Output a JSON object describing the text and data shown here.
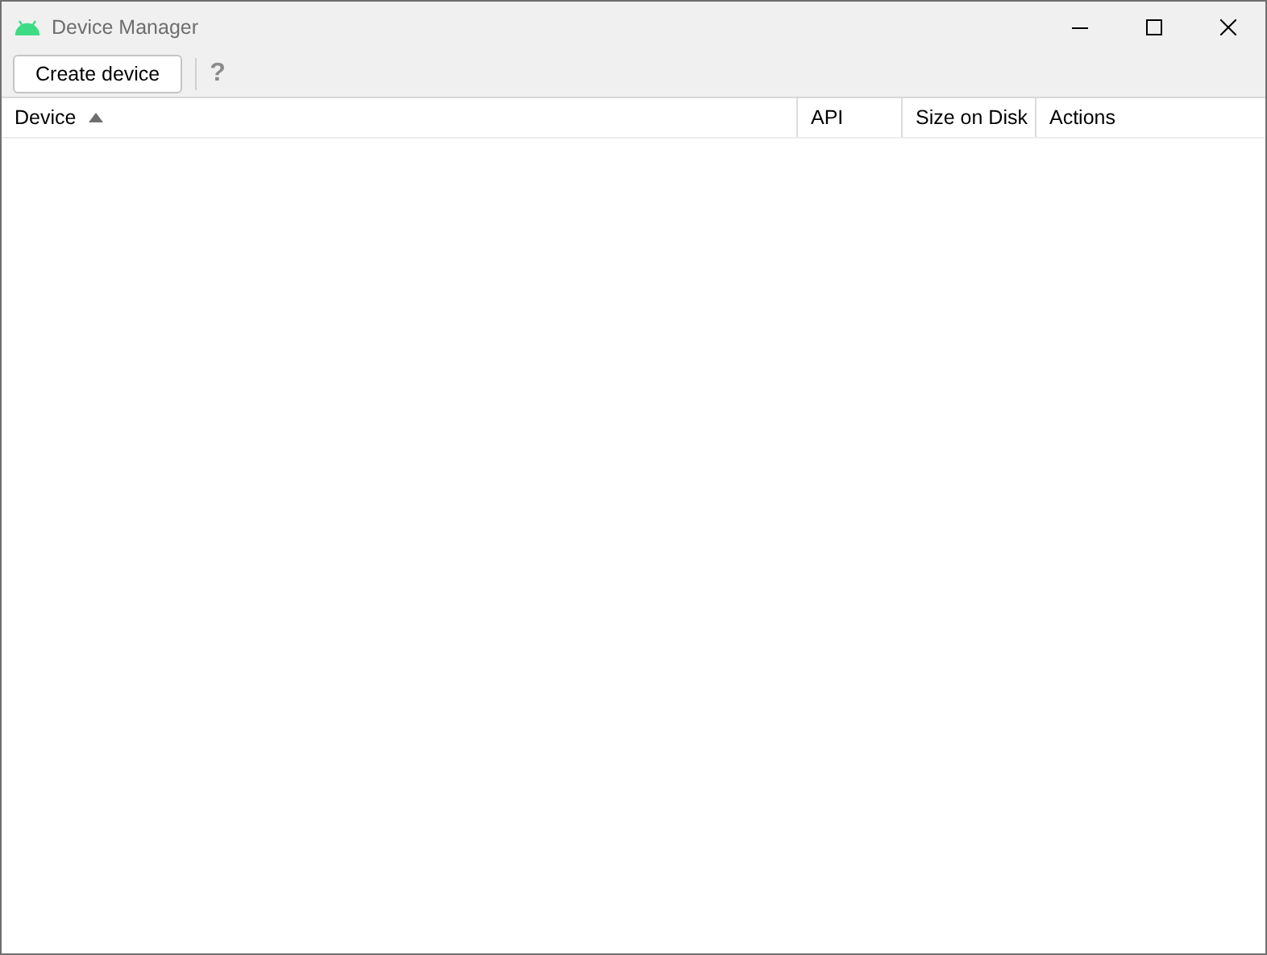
{
  "window": {
    "title": "Device Manager"
  },
  "toolbar": {
    "create_button": "Create device",
    "help": "?"
  },
  "table": {
    "columns": [
      {
        "label": "Device",
        "sorted": true
      },
      {
        "label": "API",
        "sorted": false
      },
      {
        "label": "Size on Disk",
        "sorted": false
      },
      {
        "label": "Actions",
        "sorted": false
      }
    ]
  }
}
